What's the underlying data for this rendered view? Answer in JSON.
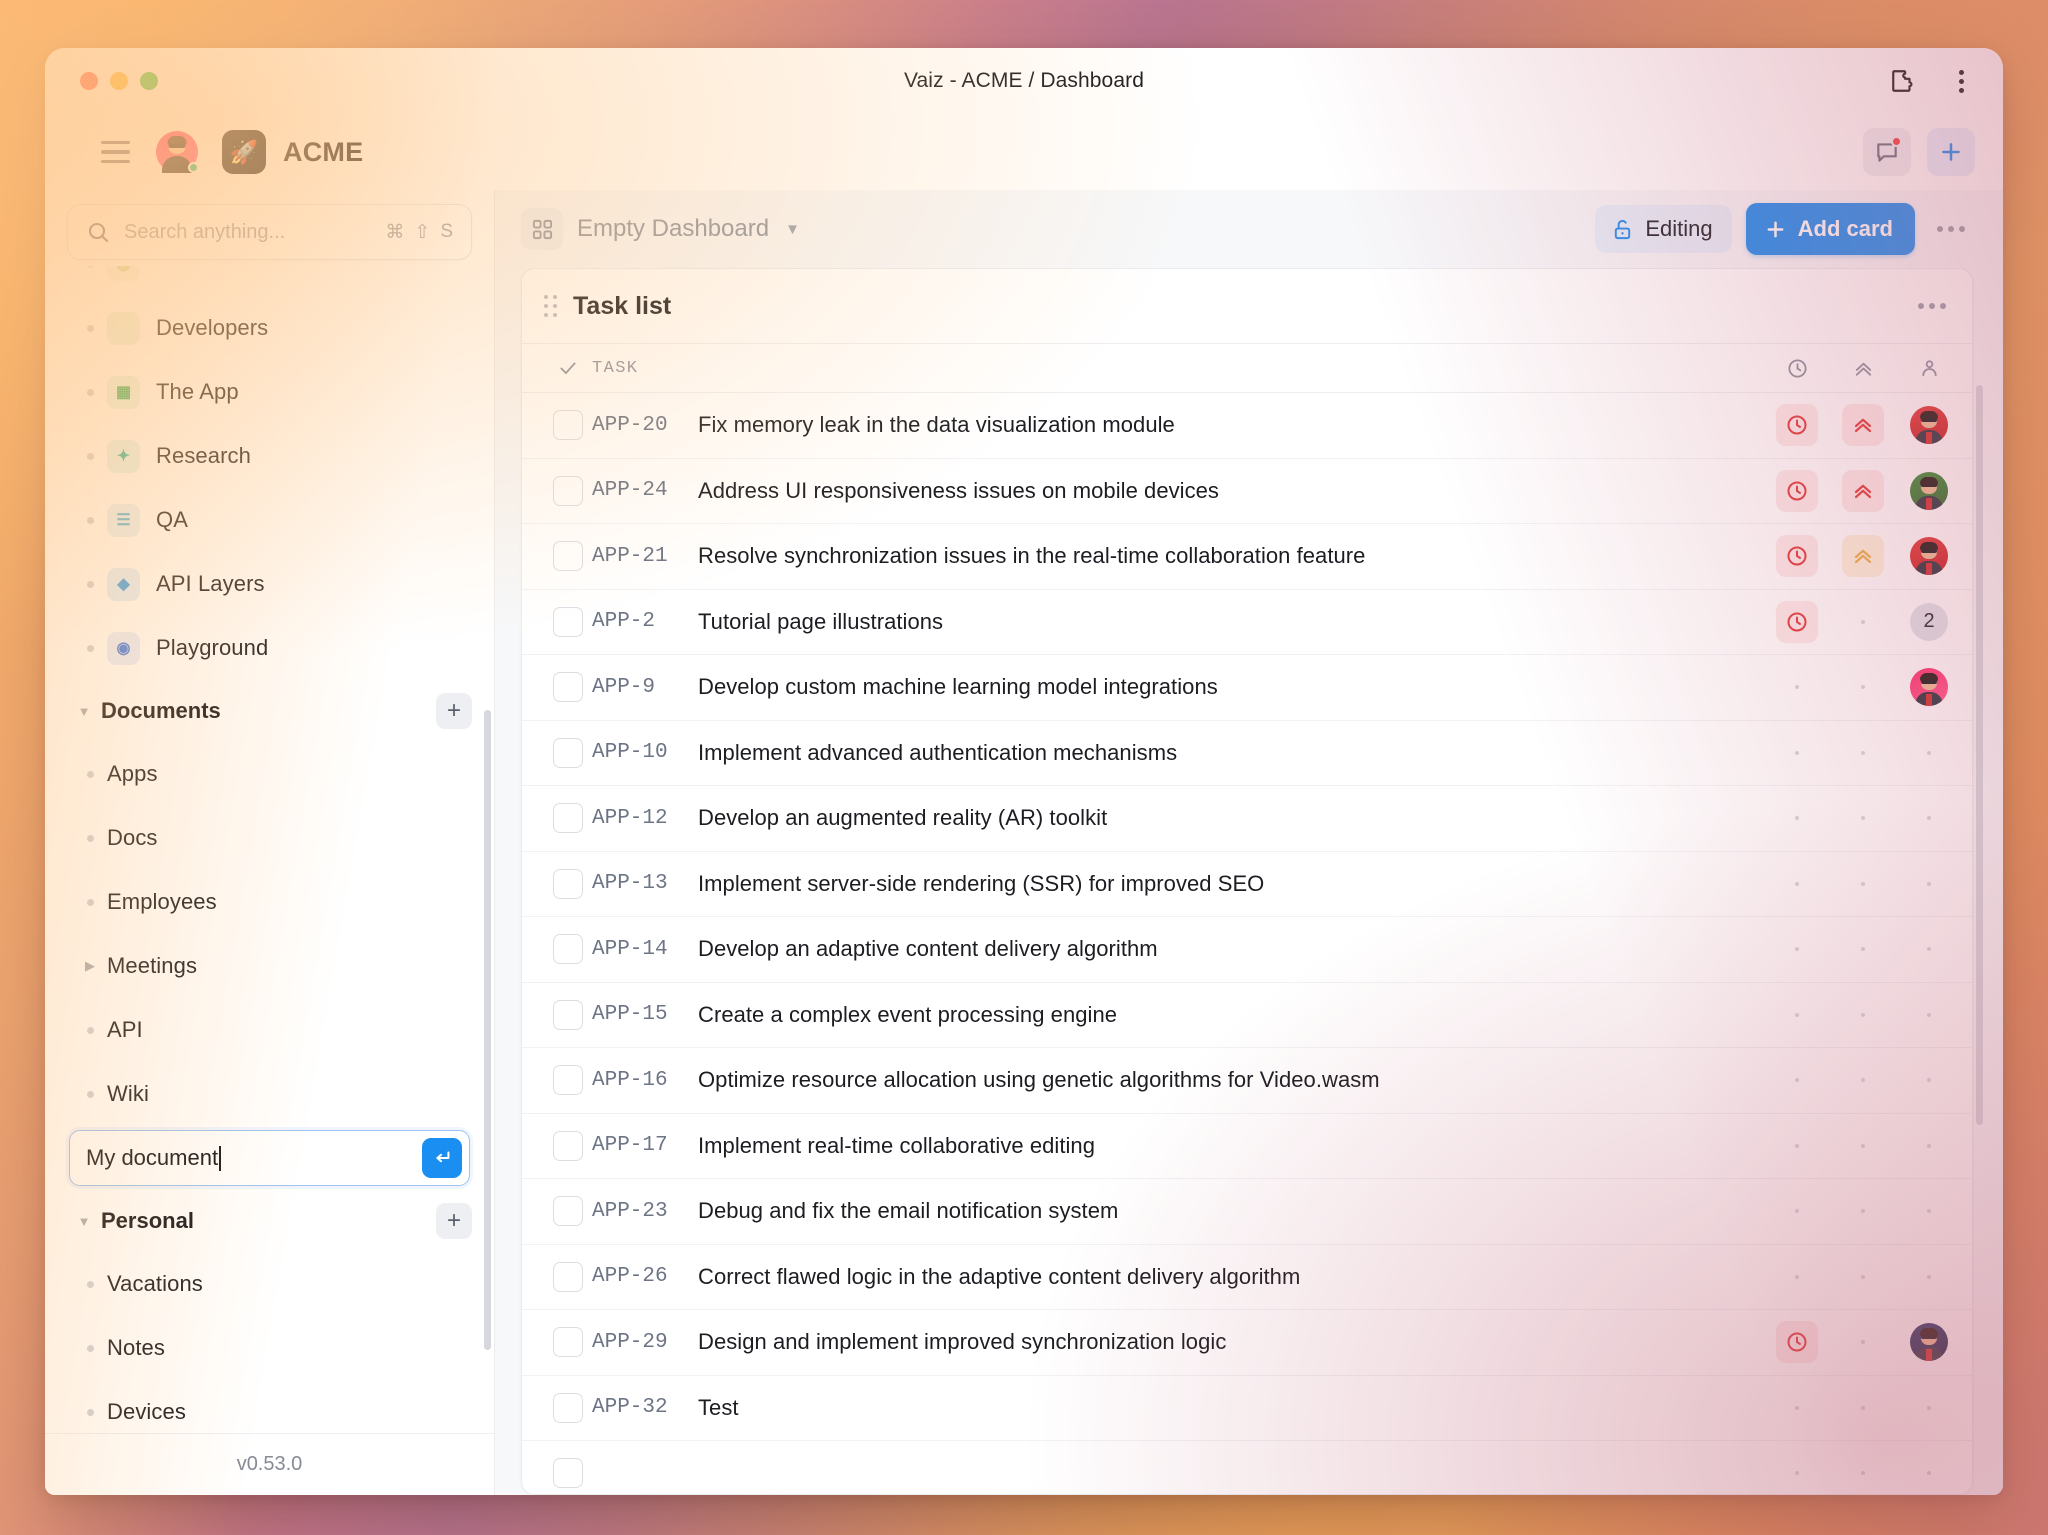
{
  "window": {
    "title": "Vaiz - ACME / Dashboard",
    "traffic_lights": [
      "close",
      "minimize",
      "maximize"
    ],
    "extension_icon": "puzzle-piece-icon",
    "overflow_icon": "vertical-kebab-icon"
  },
  "appbar": {
    "menu_icon": "hamburger-menu-icon",
    "user_avatar": "user-avatar",
    "org_logo_glyph": "🚀",
    "org_name": "ACME",
    "notifications_icon": "chat-bubble-icon",
    "has_unread": true,
    "add_icon": "plus-icon"
  },
  "search": {
    "placeholder": "Search anything...",
    "icon": "search-icon",
    "shortcut": [
      "⌘",
      "⇧",
      "S"
    ]
  },
  "sidebar": {
    "projects": [
      {
        "label": "Developers",
        "icon": "code-brackets-icon",
        "icon_glyph": "</>",
        "bg": "#e8f7ea",
        "fg": "#45b35c"
      },
      {
        "label": "The App",
        "icon": "grid-squares-icon",
        "icon_glyph": "▦",
        "bg": "#e6f7ec",
        "fg": "#2fae62"
      },
      {
        "label": "Research",
        "icon": "sparkle-icon",
        "icon_glyph": "✦",
        "bg": "#e2f6f2",
        "fg": "#2bb7a3"
      },
      {
        "label": "QA",
        "icon": "checklist-icon",
        "icon_glyph": "☰",
        "bg": "#e5f3fb",
        "fg": "#52b3e0"
      },
      {
        "label": "API Layers",
        "icon": "layers-icon",
        "icon_glyph": "◆",
        "bg": "#e2f0fc",
        "fg": "#3ba1e8"
      },
      {
        "label": "Playground",
        "icon": "teddy-bear-icon",
        "icon_glyph": "◉",
        "bg": "#e8eefc",
        "fg": "#4a7fe0"
      }
    ],
    "documents_group": {
      "label": "Documents",
      "add_label": "+",
      "expanded": true
    },
    "documents": [
      {
        "label": "Apps",
        "expandable": false
      },
      {
        "label": "Docs",
        "expandable": false
      },
      {
        "label": "Employees",
        "expandable": false
      },
      {
        "label": "Meetings",
        "expandable": true
      },
      {
        "label": "API",
        "expandable": false
      },
      {
        "label": "Wiki",
        "expandable": false
      }
    ],
    "new_document_input": {
      "value": "My document",
      "submit_icon": "enter-return-icon",
      "focused": true
    },
    "personal_group": {
      "label": "Personal",
      "add_label": "+",
      "expanded": true
    },
    "personal": [
      {
        "label": "Vacations"
      },
      {
        "label": "Notes"
      },
      {
        "label": "Devices"
      }
    ],
    "version": "v0.53.0"
  },
  "toolbar": {
    "dashboard_icon": "dashboard-grid-icon",
    "dashboard_name": "Empty Dashboard",
    "dropdown_icon": "chevron-down-icon",
    "editing_label": "Editing",
    "editing_icon": "unlock-icon",
    "add_card_label": "Add card",
    "add_card_icon": "plus-icon",
    "more_icon": "horizontal-kebab-icon",
    "accent_color": "#1f8ff2"
  },
  "card": {
    "title": "Task list",
    "drag_icon": "drag-handle-icon",
    "more_icon": "horizontal-kebab-icon"
  },
  "table": {
    "headers": {
      "check": "check-icon",
      "task": "TASK",
      "due": "clock-icon",
      "priority": "priority-chevrons-icon",
      "assignee": "person-icon"
    },
    "rows": [
      {
        "id": "APP-20",
        "title": "Fix memory leak in the data visualization module",
        "due": "overdue",
        "priority": "high",
        "assignee": "avatar-red"
      },
      {
        "id": "APP-24",
        "title": "Address UI responsiveness issues on mobile devices",
        "due": "overdue",
        "priority": "high",
        "assignee": "avatar-green"
      },
      {
        "id": "APP-21",
        "title": "Resolve synchronization issues in the real-time collaboration feature",
        "due": "overdue",
        "priority": "medium",
        "assignee": "avatar-red"
      },
      {
        "id": "APP-2",
        "title": "Tutorial page illustrations",
        "due": "overdue",
        "priority": null,
        "assignee": "count",
        "assignee_count": "2"
      },
      {
        "id": "APP-9",
        "title": "Develop custom machine learning model integrations",
        "due": null,
        "priority": null,
        "assignee": "avatar-pink"
      },
      {
        "id": "APP-10",
        "title": "Implement advanced authentication mechanisms",
        "due": null,
        "priority": null,
        "assignee": null
      },
      {
        "id": "APP-12",
        "title": "Develop an augmented reality (AR) toolkit",
        "due": null,
        "priority": null,
        "assignee": null
      },
      {
        "id": "APP-13",
        "title": "Implement server-side rendering (SSR) for improved SEO",
        "due": null,
        "priority": null,
        "assignee": null
      },
      {
        "id": "APP-14",
        "title": "Develop an adaptive content delivery algorithm",
        "due": null,
        "priority": null,
        "assignee": null
      },
      {
        "id": "APP-15",
        "title": "Create a complex event processing engine",
        "due": null,
        "priority": null,
        "assignee": null
      },
      {
        "id": "APP-16",
        "title": "Optimize resource allocation using genetic algorithms for Video.wasm",
        "due": null,
        "priority": null,
        "assignee": null
      },
      {
        "id": "APP-17",
        "title": "Implement real-time collaborative editing",
        "due": null,
        "priority": null,
        "assignee": null
      },
      {
        "id": "APP-23",
        "title": "Debug and fix the email notification system",
        "due": null,
        "priority": null,
        "assignee": null
      },
      {
        "id": "APP-26",
        "title": "Correct flawed logic in the adaptive content delivery algorithm",
        "due": null,
        "priority": null,
        "assignee": null
      },
      {
        "id": "APP-29",
        "title": "Design and implement improved synchronization logic",
        "due": "overdue",
        "priority": null,
        "assignee": "avatar-blue"
      },
      {
        "id": "APP-32",
        "title": "Test",
        "due": null,
        "priority": null,
        "assignee": null
      },
      {
        "id": "",
        "title": "",
        "due": null,
        "priority": null,
        "assignee": null
      }
    ]
  }
}
